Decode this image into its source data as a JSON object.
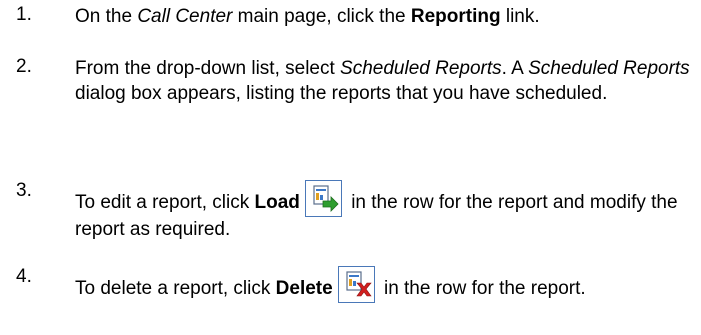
{
  "steps": [
    {
      "number": "1.",
      "p1": "On the ",
      "em1": "Call Center",
      "p2": " main page, click the ",
      "strong1": "Reporting",
      "p3": " link."
    },
    {
      "number": "2.",
      "p1": "From the drop-down list, select ",
      "em1": "Scheduled Reports",
      "p2": ".  A ",
      "em2": "Scheduled Reports",
      "p3": " dialog box appears, listing the reports that you have scheduled."
    },
    {
      "number": "3.",
      "p1": "To edit a report, click ",
      "strong1": "Load",
      "icon": "load-report-icon",
      "p2": " in the row for the report and modify the report as required."
    },
    {
      "number": "4.",
      "p1": "To delete a report, click ",
      "strong1": "Delete",
      "icon": "delete-report-icon",
      "p2": " in the row for the report."
    }
  ],
  "colors": {
    "icon_border": "#4a78b8",
    "load_arrow": "#2f9e2f",
    "delete_x": "#d21f1f"
  }
}
